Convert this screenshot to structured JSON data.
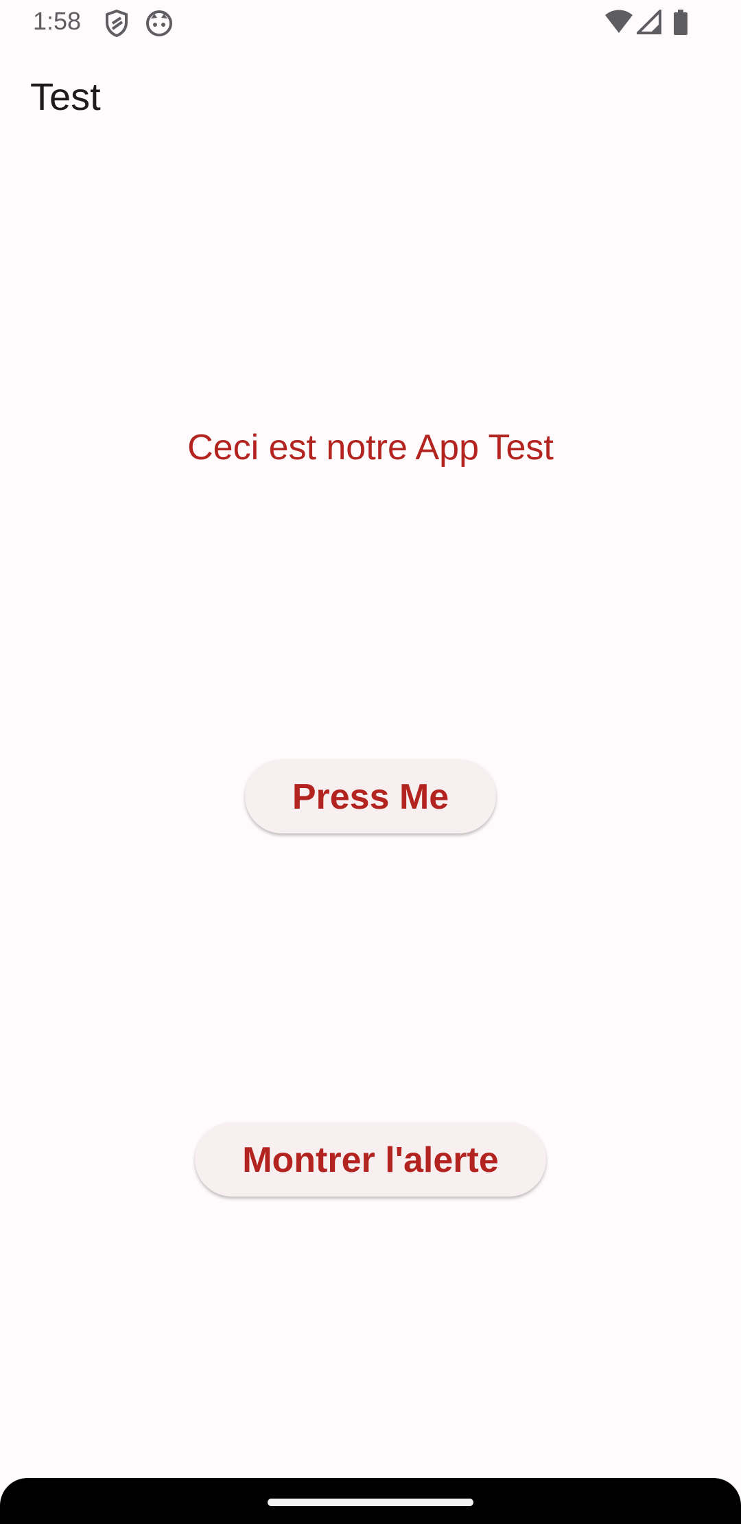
{
  "status_bar": {
    "time": "1:58",
    "icons": [
      "shield-icon",
      "face-icon",
      "wifi-icon",
      "signal-icon",
      "battery-icon"
    ]
  },
  "app_bar": {
    "title": "Test"
  },
  "main": {
    "headline": "Ceci est notre App Test",
    "press_button_label": "Press Me",
    "alert_button_label": "Montrer l'alerte"
  },
  "colors": {
    "accent": "#b3231f",
    "background": "#fffbfc",
    "button_bg": "#f8f0f0"
  }
}
